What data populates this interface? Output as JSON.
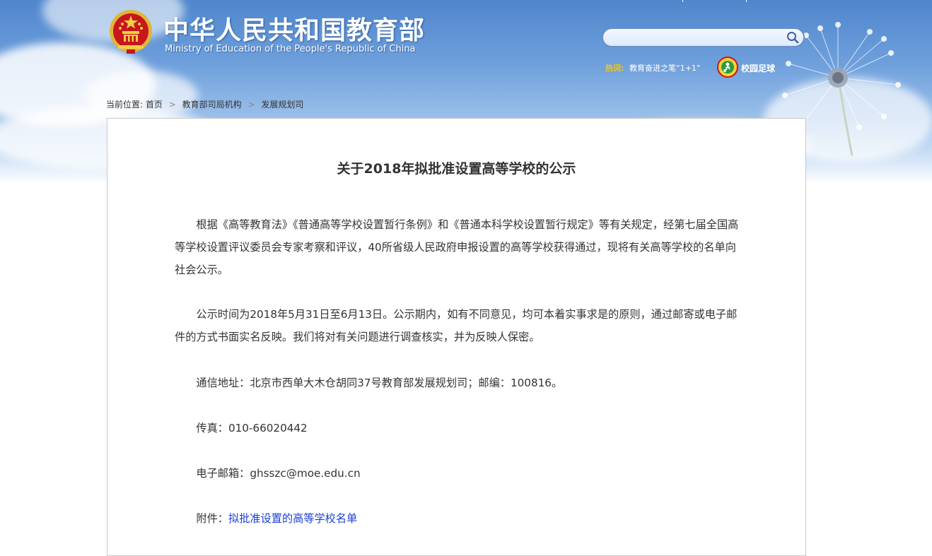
{
  "header": {
    "title": "中华人民共和国教育部",
    "subtitle": "Ministry of Education of the People's Republic of China",
    "search": {
      "placeholder": ""
    },
    "hot": {
      "label": "热词:",
      "link": "教育奋进之笔“1+1”"
    },
    "football": {
      "label": "校园足球"
    }
  },
  "breadcrumb": {
    "prefix": "当前位置:",
    "items": [
      "首页",
      "教育部司局机构",
      "发展规划司"
    ],
    "separator": ">"
  },
  "article": {
    "title": "关于2018年拟批准设置高等学校的公示",
    "paragraphs": [
      "根据《高等教育法》《普通高等学校设置暂行条例》和《普通本科学校设置暂行规定》等有关规定，经第七届全国高等学校设置评议委员会专家考察和评议，40所省级人民政府申报设置的高等学校获得通过，现将有关高等学校的名单向社会公示。",
      "公示时间为2018年5月31日至6月13日。公示期内，如有不同意见，均可本着实事求是的原则，通过邮寄或电子邮件的方式书面实名反映。我们将对有关问题进行调查核实，并为反映人保密。",
      "通信地址：北京市西单大木仓胡同37号教育部发展规划司；邮编：100816。",
      "传真：010-66020442",
      "电子邮箱：ghsszc@moe.edu.cn"
    ],
    "attachment": {
      "label": "附件：",
      "link": "拟批准设置的高等学校名单"
    }
  },
  "colors": {
    "header_sky": "#6fa0dc",
    "hot_label": "#f5c518",
    "link_blue": "#1a3fd6",
    "text": "#333333"
  }
}
